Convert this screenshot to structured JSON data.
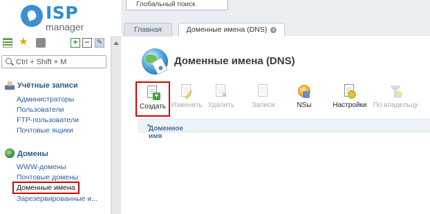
{
  "logo": {
    "brand": "ISP",
    "product": "manager"
  },
  "left_search": {
    "placeholder": "Ctrl + Shift + M"
  },
  "global_search": {
    "placeholder": "Глобальный поиск"
  },
  "tabs": [
    {
      "label": "Главная"
    },
    {
      "label": "Доменные имена (DNS)"
    }
  ],
  "sections": [
    {
      "title": "Учётные записи",
      "icon": "user-icon",
      "items": [
        "Администраторы",
        "Пользователи",
        "FTP-пользователи",
        "Почтовые ящики"
      ]
    },
    {
      "title": "Домены",
      "icon": "globe-icon",
      "items": [
        "WWW-домены",
        "Почтовые домены",
        "Доменные имена",
        "Зарезервированные и..."
      ]
    }
  ],
  "page": {
    "title": "Доменные имена (DNS)"
  },
  "toolbar": {
    "create": "Создать",
    "edit": "Изменить",
    "delete": "Удалить",
    "records": "Записи",
    "ns": "NSы",
    "settings": "Настройки",
    "by_owner": "По владельцу"
  },
  "table": {
    "columns": [
      "Доменное имя"
    ]
  },
  "colors": {
    "accent": "#2f8ad2",
    "highlight": "#d40000",
    "link": "#2b5f9e"
  }
}
